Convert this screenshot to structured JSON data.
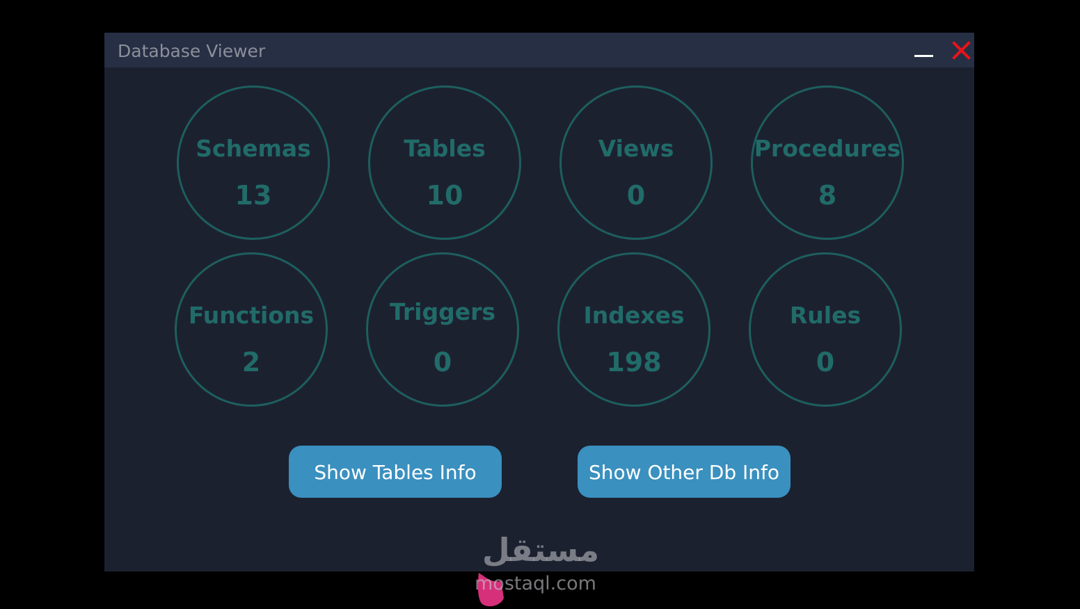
{
  "window": {
    "title": "Database Viewer",
    "controls": {
      "minimize": "minimize-icon",
      "close": "close-icon"
    },
    "colors": {
      "background": "#1c2130",
      "titlebar": "#262f44",
      "title_text": "#8b8f99",
      "accent": "#216b69",
      "button": "#3a90bf",
      "close": "#e8141a"
    }
  },
  "stats": [
    {
      "label": "Schemas",
      "value": "13"
    },
    {
      "label": "Tables",
      "value": "10"
    },
    {
      "label": "Views",
      "value": "0"
    },
    {
      "label": "Procedures",
      "value": "8"
    },
    {
      "label": "Functions",
      "value": "2"
    },
    {
      "label": "Triggers",
      "value": "0"
    },
    {
      "label": "Indexes",
      "value": "198"
    },
    {
      "label": "Rules",
      "value": "0"
    }
  ],
  "buttons": {
    "show_tables": "Show Tables Info",
    "show_other": "Show Other Db Info"
  },
  "watermark": {
    "arabic": "مستقل",
    "latin": "mostaql.com"
  }
}
